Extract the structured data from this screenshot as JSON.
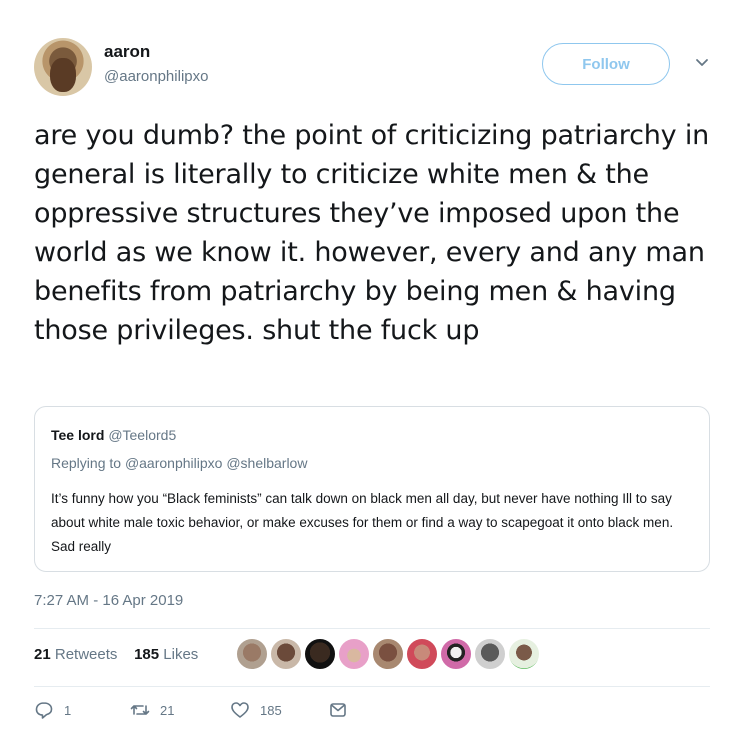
{
  "author": {
    "name": "aaron",
    "handle": "@aaronphilipxo"
  },
  "follow_label": "Follow",
  "tweet_text": "are you dumb? the point of criticizing patriarchy in general is literally to criticize white men & the oppressive structures they’ve imposed upon the world as we know it. however, every and any man benefits from patriarchy by being men & having those privileges. shut the fuck up",
  "quote": {
    "name": "Tee lord",
    "handle": "@Teelord5",
    "replying_prefix": "Replying to",
    "replying_mentions": "@aaronphilipxo @shelbarlow",
    "text": "It’s funny how you “Black feminists” can talk down on black men all day, but never have nothing Ill to say about white male toxic behavior, or make excuses for them or find a way to scapegoat it onto black men. Sad really"
  },
  "timestamp": "7:27 AM - 16 Apr 2019",
  "stats": {
    "retweets_count": "21",
    "retweets_label": "Retweets",
    "likes_count": "185",
    "likes_label": "Likes"
  },
  "actions": {
    "reply_count": "1",
    "retweet_count": "21",
    "like_count": "185"
  },
  "icons": {
    "caret": "chevron-down-icon",
    "reply": "reply-icon",
    "retweet": "retweet-icon",
    "like": "heart-icon",
    "dm": "envelope-icon"
  },
  "colors": {
    "follow_border": "#8fc7ee",
    "muted": "#657786",
    "text": "#14171a"
  }
}
